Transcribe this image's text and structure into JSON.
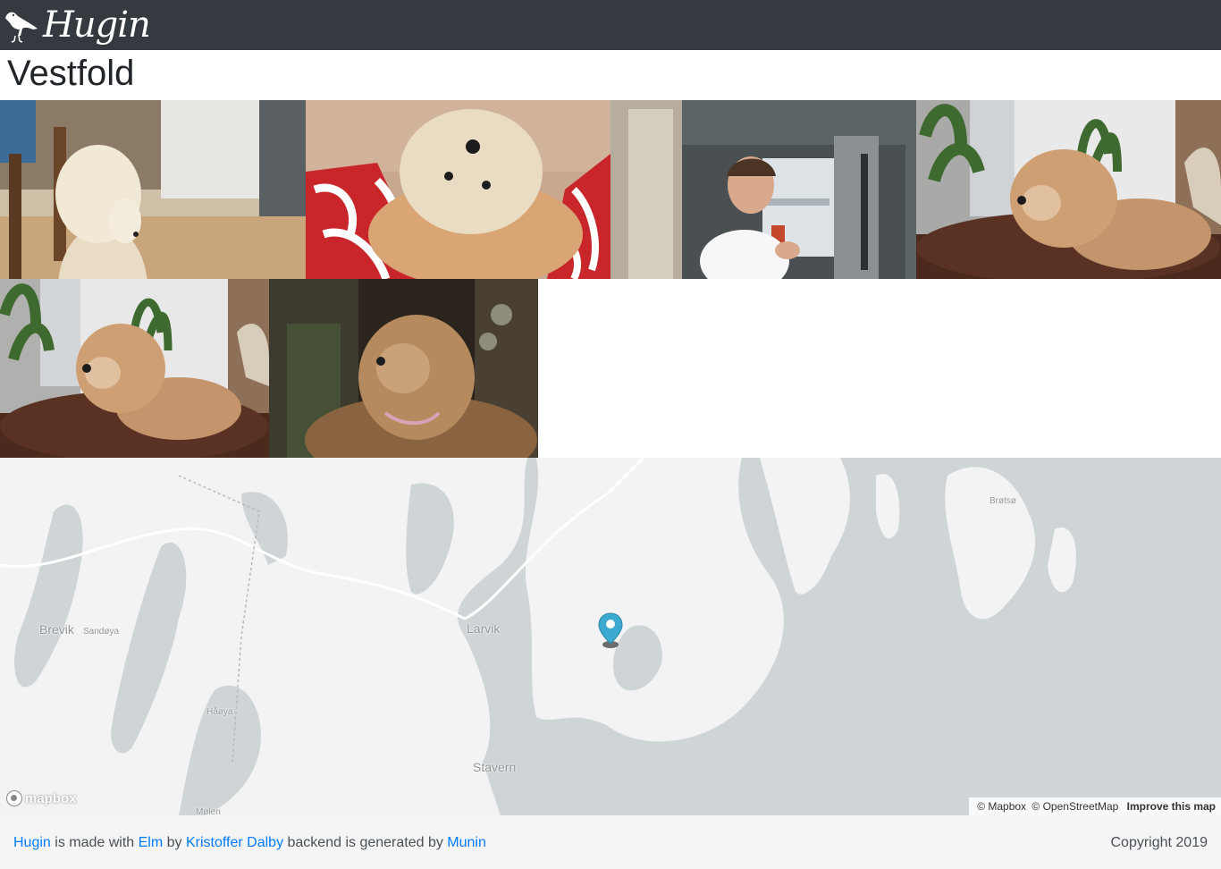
{
  "navbar": {
    "brand": "Hugin",
    "logo_icon": "raven-icon"
  },
  "page": {
    "title": "Vestfold"
  },
  "photos": [
    {
      "subject": "dog sitting on wooden floor"
    },
    {
      "subject": "dog looking up between red patterned fabric"
    },
    {
      "subject": "man at open refrigerator"
    },
    {
      "subject": "dog lying on fur by window"
    },
    {
      "subject": "dog lying on fur by window"
    },
    {
      "subject": "dog in dim light"
    }
  ],
  "map": {
    "places": [
      "Brevik",
      "Sandøya",
      "Larvik",
      "Håøya",
      "Stavern",
      "Brøtsø",
      "Mølen"
    ],
    "logo": "mapbox",
    "attribution": {
      "mapbox": "© Mapbox",
      "osm": "© OpenStreetMap",
      "improve": "Improve this map"
    },
    "marker_color": "#3ba9d0"
  },
  "footer": {
    "hugin": "Hugin",
    "made_with": " is made with ",
    "elm": "Elm",
    "by": " by ",
    "author": "Kristoffer Dalby",
    "backend": " backend is generated by ",
    "munin": "Munin",
    "copyright": "Copyright 2019"
  }
}
